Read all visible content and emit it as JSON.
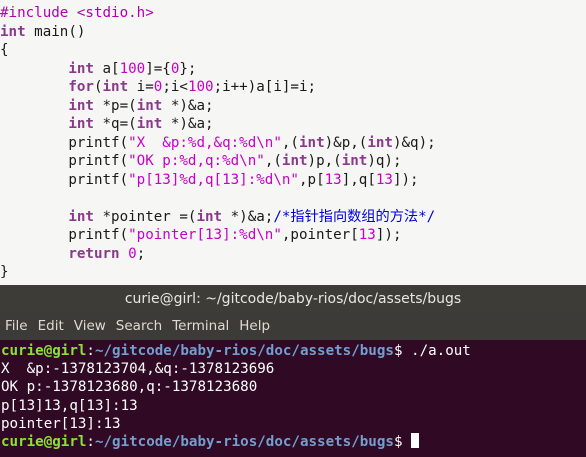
{
  "editor": {
    "l1_pp": "#include <stdio.h>",
    "l2_kw": "int",
    "l2_rest": " main()",
    "l3": "{",
    "l4_kw": "int",
    "l4_a": " a[",
    "l4_n1": "100",
    "l4_b": "]={",
    "l4_n2": "0",
    "l4_c": "};",
    "l5_kw1": "for",
    "l5_a": "(",
    "l5_kw2": "int",
    "l5_b": " i=",
    "l5_n1": "0",
    "l5_c": ";i<",
    "l5_n2": "100",
    "l5_d": ";i++)a[i]=i;",
    "l6_kw1": "int",
    "l6_a": " *p=(",
    "l6_kw2": "int",
    "l6_b": " *)&a;",
    "l7_kw1": "int",
    "l7_a": " *q=(",
    "l7_kw2": "int",
    "l7_b": " *)&a;",
    "l8_a": "printf(",
    "l8_s": "\"X  &p:%d,&q:%d\\n\"",
    "l8_b": ",(",
    "l8_kw1": "int",
    "l8_c": ")&p,(",
    "l8_kw2": "int",
    "l8_d": ")&q);",
    "l9_a": "printf(",
    "l9_s": "\"OK p:%d,q:%d\\n\"",
    "l9_b": ",(",
    "l9_kw1": "int",
    "l9_c": ")p,(",
    "l9_kw2": "int",
    "l9_d": ")q);",
    "l10_a": "printf(",
    "l10_s": "\"p[13]%d,q[13]:%d\\n\"",
    "l10_b": ",p[",
    "l10_n1": "13",
    "l10_c": "],q[",
    "l10_n2": "13",
    "l10_d": "]);",
    "l12_kw1": "int",
    "l12_a": " *pointer =(",
    "l12_kw2": "int",
    "l12_b": " *)&a;",
    "l12_com": "/*指针指向数组的方法*/",
    "l13_a": "printf(",
    "l13_s": "\"pointer[13]:%d\\n\"",
    "l13_b": ",pointer[",
    "l13_n": "13",
    "l13_c": "]);",
    "l14_kw": "return",
    "l14_a": " ",
    "l14_n": "0",
    "l14_b": ";",
    "l15": "}"
  },
  "terminal": {
    "title": "curie@girl: ~/gitcode/baby-rios/doc/assets/bugs",
    "menu": [
      "File",
      "Edit",
      "View",
      "Search",
      "Terminal",
      "Help"
    ],
    "prompt_user": "curie@girl",
    "prompt_sep": ":",
    "prompt_path": "~/gitcode/baby-rios/doc/assets/bugs",
    "prompt_dollar": "$",
    "command": " ./a.out",
    "output": [
      "X  &p:-1378123704,&q:-1378123696",
      "OK p:-1378123680,q:-1378123680",
      "p[13]13,q[13]:13",
      "pointer[13]:13"
    ],
    "prompt_tail": " "
  },
  "colors": {
    "editor_bg": "#f6f6f4",
    "terminal_bg": "#300a24",
    "prompt_user": "#8ae234",
    "prompt_path": "#729fcf",
    "keyword": "#8b3a8b",
    "string": "#c800c8",
    "comment": "#0000dd"
  }
}
